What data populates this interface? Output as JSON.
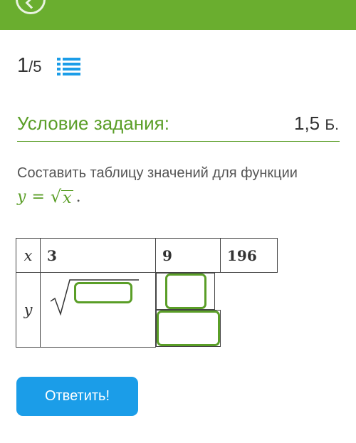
{
  "counter": {
    "current": "1",
    "total": "/5"
  },
  "section": {
    "title": "Условие задания:",
    "points_value": "1,5",
    "points_unit": "Б."
  },
  "task": {
    "text": "Составить таблицу значений для функции",
    "formula": {
      "lhs": "y",
      "eq": "=",
      "radicand": "x",
      "period": "."
    }
  },
  "table": {
    "x_header": "x",
    "y_header": "y",
    "x_values": [
      "3",
      "9",
      "196"
    ],
    "y_answers": [
      "",
      "",
      ""
    ]
  },
  "submit_label": "Ответить!",
  "colors": {
    "accent": "#6aae2f",
    "button": "#1b9de8"
  },
  "icons": [
    "back-icon",
    "list-icon"
  ]
}
